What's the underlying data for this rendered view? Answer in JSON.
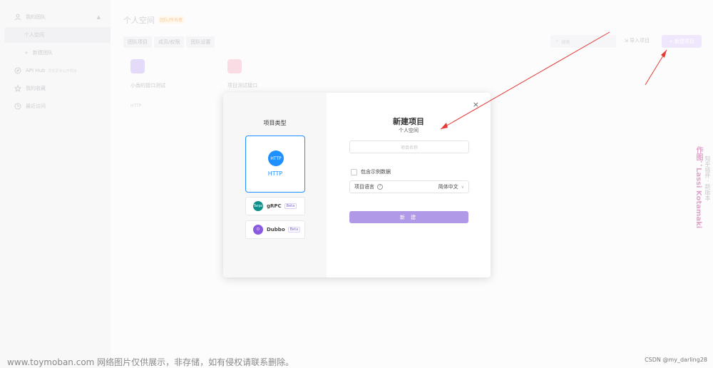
{
  "sidebar": {
    "team_label": "我的团队",
    "personal_space": "个人空间",
    "new_team": "新建团队",
    "api_hub": "API Hub",
    "api_hub_desc": "发现更多公开项目",
    "favorites": "我的收藏",
    "recent": "最近访问"
  },
  "header": {
    "title": "个人空间",
    "badge": "团队/所有者",
    "tabs": [
      "团队项目",
      "成员/权限",
      "团队设置"
    ],
    "search_placeholder": "搜索",
    "import_label": "导入项目",
    "new_project_label": "+ 新建项目"
  },
  "projects": [
    {
      "name": "小香的接口测试",
      "tag": "HTTP"
    },
    {
      "name": "项目测试接口"
    }
  ],
  "modal": {
    "type_title": "项目类型",
    "types": [
      {
        "name": "HTTP",
        "icon_text": "HTTP"
      },
      {
        "name": "gRPC",
        "badge": "Beta",
        "icon_text": "Tarpc"
      },
      {
        "name": "Dubbo",
        "badge": "Beta",
        "icon_text": "D"
      }
    ],
    "title": "新建项目",
    "subtitle": "个人空间",
    "name_placeholder": "项目名称",
    "sample_label": "包含示例数据",
    "lang_label": "项目语言",
    "lang_value": "简体中文",
    "create_label": "新 建",
    "close_symbol": "×"
  },
  "watermarks": {
    "author": "作图：Lassi Kotamaki",
    "side_text": "知乎插件 · 新版本",
    "footer_left": "www.toymoban.com 网络图片仅供展示，非存储，如有侵权请联系删除。",
    "footer_right": "CSDN @my_darling28"
  },
  "colors": {
    "accent": "#b09ae8",
    "http_blue": "#1e90ff",
    "arrow_red": "#e53935"
  }
}
